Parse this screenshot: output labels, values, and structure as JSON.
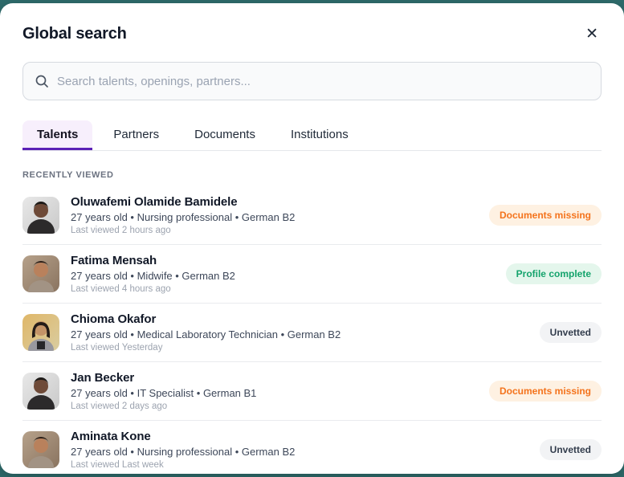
{
  "modal": {
    "title": "Global search",
    "close_icon": "✕"
  },
  "search": {
    "placeholder": "Search talents, openings, partners...",
    "value": "",
    "icon": "search-icon"
  },
  "tabs": [
    {
      "label": "Talents",
      "active": true
    },
    {
      "label": "Partners",
      "active": false
    },
    {
      "label": "Documents",
      "active": false
    },
    {
      "label": "Institutions",
      "active": false
    }
  ],
  "section": {
    "heading": "RECENTLY VIEWED"
  },
  "results": [
    {
      "name": "Oluwafemi Olamide Bamidele",
      "details": "27 years old • Nursing professional • German B2",
      "last_viewed": "Last viewed 2 hours ago",
      "badge": "Documents missing",
      "badge_type": "warning"
    },
    {
      "name": "Fatima Mensah",
      "details": "27 years old • Midwife • German B2",
      "last_viewed": "Last viewed 4 hours ago",
      "badge": "Profile complete",
      "badge_type": "success"
    },
    {
      "name": "Chioma Okafor",
      "details": "27 years old • Medical Laboratory Technician • German B2",
      "last_viewed": "Last viewed Yesterday",
      "badge": "Unvetted",
      "badge_type": "neutral"
    },
    {
      "name": "Jan Becker",
      "details": "27 years old • IT Specialist • German B1",
      "last_viewed": "Last viewed 2 days ago",
      "badge": "Documents missing",
      "badge_type": "warning"
    },
    {
      "name": "Aminata Kone",
      "details": "27 years old • Nursing professional • German B2",
      "last_viewed": "Last viewed Last week",
      "badge": "Unvetted",
      "badge_type": "neutral"
    }
  ],
  "colors": {
    "backdrop_teal": "#2f6d6d",
    "accent_purple": "#5b21b6",
    "active_tab_bg": "#f7effc",
    "badge_warning_text": "#f4731c",
    "badge_warning_bg": "#fef1e2",
    "badge_success_text": "#14a36c",
    "badge_success_bg": "#e4f6ec",
    "badge_neutral_text": "#333d4d",
    "badge_neutral_bg": "#f2f3f5"
  }
}
